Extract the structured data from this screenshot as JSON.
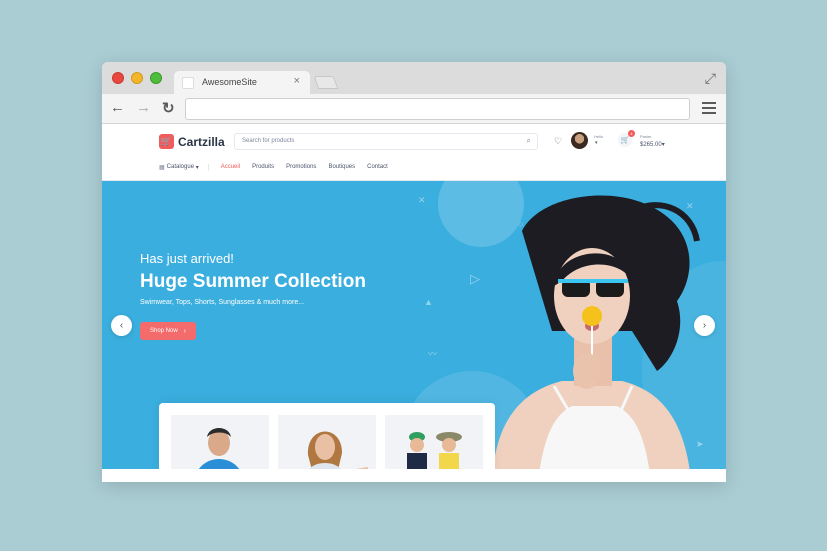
{
  "browser": {
    "tab_title": "AwesomeSite",
    "tab_close": "×",
    "back_icon": "arrow-left-icon",
    "forward_icon": "arrow-right-icon",
    "reload_icon": "reload-icon",
    "address": ""
  },
  "header": {
    "logo_text": "Cartzilla",
    "search_placeholder": "Search for products",
    "account_label": "Hello",
    "cart_count": "4",
    "cart_label": "Panier",
    "cart_total": "$265.00"
  },
  "nav": {
    "catalogue": "Catalogue",
    "links": [
      "Accueil",
      "Produits",
      "Promotions",
      "Boutiques",
      "Contact"
    ],
    "active_index": 0
  },
  "hero": {
    "subtitle": "Has just arrived!",
    "title": "Huge Summer Collection",
    "description": "Swimwear, Tops, Shorts, Sunglasses & much more...",
    "button_label": "Shop Now"
  },
  "colors": {
    "brand": "#f05b5b",
    "hero_bg": "#3aaede",
    "page_bg": "#a9cdd3"
  }
}
